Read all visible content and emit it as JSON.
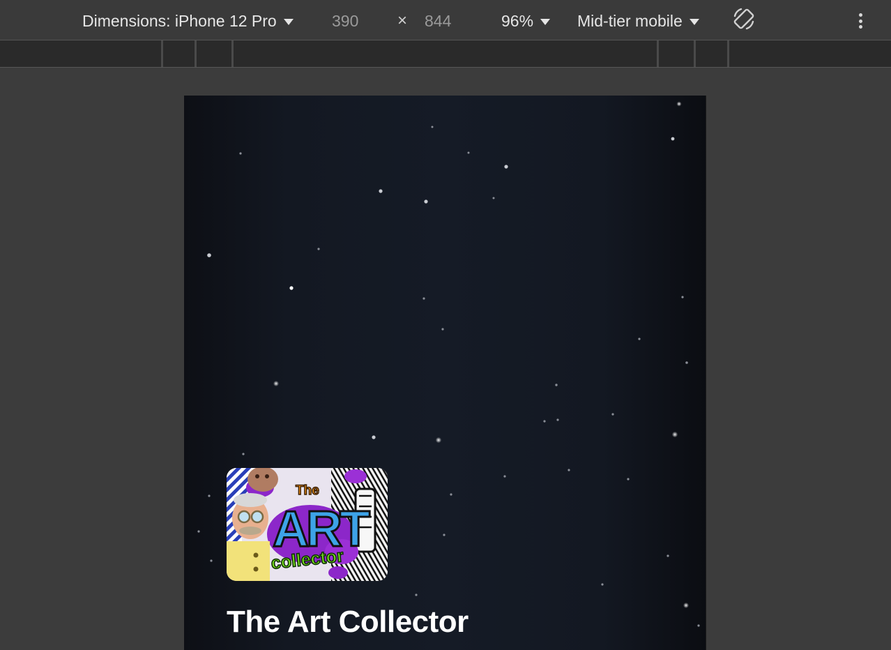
{
  "devtools": {
    "device_label": "Dimensions: iPhone 12 Pro",
    "width_value": "390",
    "times_symbol": "×",
    "height_value": "844",
    "zoom": "96%",
    "throttle": "Mid-tier mobile",
    "rotate_icon": "rotate-device-icon",
    "more_icon": "more-options-icon"
  },
  "page": {
    "app_title": "The Art Collector",
    "logo_text": {
      "the": "The",
      "art": "ART",
      "collector": "collector"
    }
  },
  "colors": {
    "toolbar_bg": "#3a3a3a",
    "ruler_bg": "#2a2a2a",
    "canvas_bg": "#3c3c3c",
    "page_bg": "#131822",
    "title_text": "#ffffff"
  }
}
